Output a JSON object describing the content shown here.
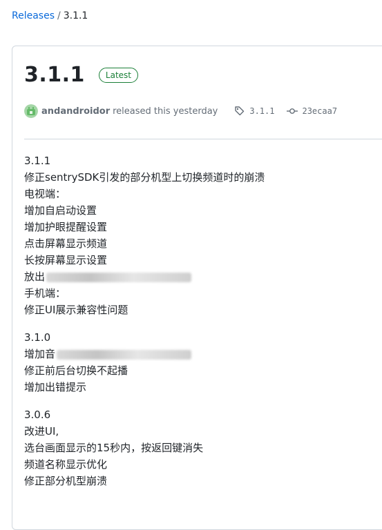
{
  "breadcrumb": {
    "root": "Releases",
    "separator": "/",
    "current": "3.1.1"
  },
  "release": {
    "title": "3.1.1",
    "badge": "Latest",
    "author": "andandroidor",
    "released_text": "released this yesterday",
    "tag": "3.1.1",
    "commit": "23ecaa7"
  },
  "notes": {
    "v311": {
      "heading": "3.1.1",
      "line1": "修正sentrySDK引发的部分机型上切换频道时的崩溃",
      "line2": "电视端：",
      "line3": "增加自启动设置",
      "line4": "增加护眼提醒设置",
      "line5": "点击屏幕显示频道",
      "line6": "长按屏幕显示设置",
      "line7": "放出",
      "line8": "手机端：",
      "line9": "修正UI展示兼容性问题"
    },
    "v310": {
      "heading": "3.1.0",
      "line1": "增加音",
      "line2": "修正前后台切换不起播",
      "line3": "增加出错提示"
    },
    "v306": {
      "heading": "3.0.6",
      "line1": "改进UI,",
      "line2": "选台画面显示的15秒内，按返回键消失",
      "line3": "频道名称显示优化",
      "line4": "修正部分机型崩溃"
    }
  },
  "colors": {
    "accent": "#0969da",
    "latest_green": "#1a7f37",
    "border": "#d0d7de",
    "muted": "#636c76"
  },
  "icons": {
    "tag": "tag-icon",
    "commit": "git-commit-icon",
    "avatar": "avatar"
  }
}
